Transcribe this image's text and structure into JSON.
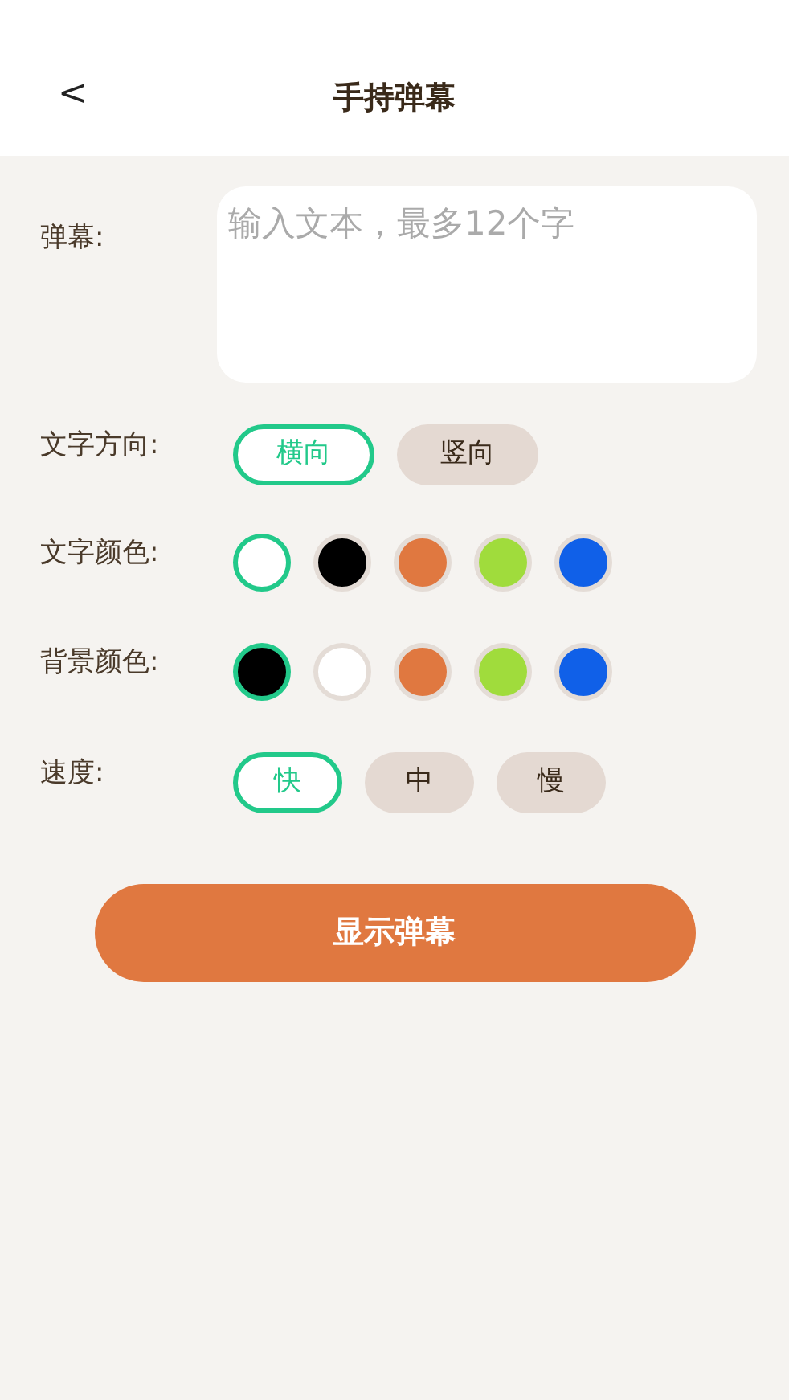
{
  "header": {
    "back": "<",
    "title": "手持弹幕"
  },
  "text_field": {
    "label": "弹幕:",
    "placeholder": "输入文本，最多12个字"
  },
  "direction": {
    "label": "文字方向:",
    "options": [
      {
        "label": "横向",
        "selected": true
      },
      {
        "label": "竖向",
        "selected": false
      }
    ]
  },
  "text_color": {
    "label": "文字颜色:",
    "swatches": [
      {
        "color": "#ffffff",
        "selected": true
      },
      {
        "color": "#000000",
        "selected": false
      },
      {
        "color": "#e07840",
        "selected": false
      },
      {
        "color": "#a0dc3c",
        "selected": false
      },
      {
        "color": "#1060e8",
        "selected": false
      }
    ]
  },
  "background_color": {
    "label": "背景颜色:",
    "swatches": [
      {
        "color": "#000000",
        "selected": true
      },
      {
        "color": "#ffffff",
        "selected": false
      },
      {
        "color": "#e07840",
        "selected": false
      },
      {
        "color": "#a0dc3c",
        "selected": false
      },
      {
        "color": "#1060e8",
        "selected": false
      }
    ]
  },
  "speed": {
    "label": "速度:",
    "options": [
      {
        "label": "快",
        "selected": true
      },
      {
        "label": "中",
        "selected": false
      },
      {
        "label": "慢",
        "selected": false
      }
    ]
  },
  "show_button": "显示弹幕"
}
